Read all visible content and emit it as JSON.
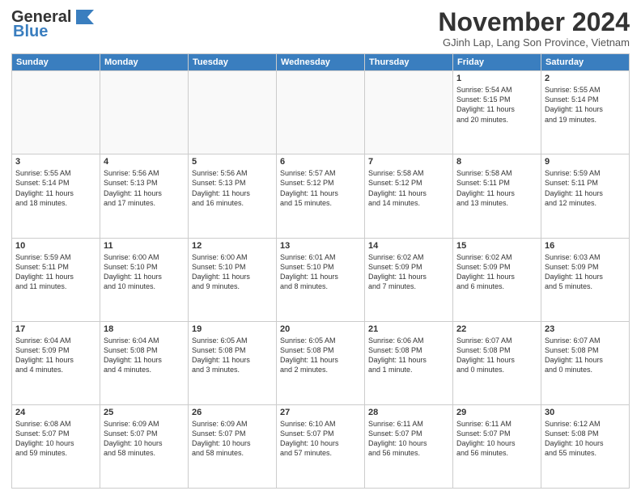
{
  "header": {
    "logo_line1": "General",
    "logo_line2": "Blue",
    "month": "November 2024",
    "location": "GJinh Lap, Lang Son Province, Vietnam"
  },
  "weekdays": [
    "Sunday",
    "Monday",
    "Tuesday",
    "Wednesday",
    "Thursday",
    "Friday",
    "Saturday"
  ],
  "weeks": [
    [
      {
        "day": "",
        "info": ""
      },
      {
        "day": "",
        "info": ""
      },
      {
        "day": "",
        "info": ""
      },
      {
        "day": "",
        "info": ""
      },
      {
        "day": "",
        "info": ""
      },
      {
        "day": "1",
        "info": "Sunrise: 5:54 AM\nSunset: 5:15 PM\nDaylight: 11 hours\nand 20 minutes."
      },
      {
        "day": "2",
        "info": "Sunrise: 5:55 AM\nSunset: 5:14 PM\nDaylight: 11 hours\nand 19 minutes."
      }
    ],
    [
      {
        "day": "3",
        "info": "Sunrise: 5:55 AM\nSunset: 5:14 PM\nDaylight: 11 hours\nand 18 minutes."
      },
      {
        "day": "4",
        "info": "Sunrise: 5:56 AM\nSunset: 5:13 PM\nDaylight: 11 hours\nand 17 minutes."
      },
      {
        "day": "5",
        "info": "Sunrise: 5:56 AM\nSunset: 5:13 PM\nDaylight: 11 hours\nand 16 minutes."
      },
      {
        "day": "6",
        "info": "Sunrise: 5:57 AM\nSunset: 5:12 PM\nDaylight: 11 hours\nand 15 minutes."
      },
      {
        "day": "7",
        "info": "Sunrise: 5:58 AM\nSunset: 5:12 PM\nDaylight: 11 hours\nand 14 minutes."
      },
      {
        "day": "8",
        "info": "Sunrise: 5:58 AM\nSunset: 5:11 PM\nDaylight: 11 hours\nand 13 minutes."
      },
      {
        "day": "9",
        "info": "Sunrise: 5:59 AM\nSunset: 5:11 PM\nDaylight: 11 hours\nand 12 minutes."
      }
    ],
    [
      {
        "day": "10",
        "info": "Sunrise: 5:59 AM\nSunset: 5:11 PM\nDaylight: 11 hours\nand 11 minutes."
      },
      {
        "day": "11",
        "info": "Sunrise: 6:00 AM\nSunset: 5:10 PM\nDaylight: 11 hours\nand 10 minutes."
      },
      {
        "day": "12",
        "info": "Sunrise: 6:00 AM\nSunset: 5:10 PM\nDaylight: 11 hours\nand 9 minutes."
      },
      {
        "day": "13",
        "info": "Sunrise: 6:01 AM\nSunset: 5:10 PM\nDaylight: 11 hours\nand 8 minutes."
      },
      {
        "day": "14",
        "info": "Sunrise: 6:02 AM\nSunset: 5:09 PM\nDaylight: 11 hours\nand 7 minutes."
      },
      {
        "day": "15",
        "info": "Sunrise: 6:02 AM\nSunset: 5:09 PM\nDaylight: 11 hours\nand 6 minutes."
      },
      {
        "day": "16",
        "info": "Sunrise: 6:03 AM\nSunset: 5:09 PM\nDaylight: 11 hours\nand 5 minutes."
      }
    ],
    [
      {
        "day": "17",
        "info": "Sunrise: 6:04 AM\nSunset: 5:09 PM\nDaylight: 11 hours\nand 4 minutes."
      },
      {
        "day": "18",
        "info": "Sunrise: 6:04 AM\nSunset: 5:08 PM\nDaylight: 11 hours\nand 4 minutes."
      },
      {
        "day": "19",
        "info": "Sunrise: 6:05 AM\nSunset: 5:08 PM\nDaylight: 11 hours\nand 3 minutes."
      },
      {
        "day": "20",
        "info": "Sunrise: 6:05 AM\nSunset: 5:08 PM\nDaylight: 11 hours\nand 2 minutes."
      },
      {
        "day": "21",
        "info": "Sunrise: 6:06 AM\nSunset: 5:08 PM\nDaylight: 11 hours\nand 1 minute."
      },
      {
        "day": "22",
        "info": "Sunrise: 6:07 AM\nSunset: 5:08 PM\nDaylight: 11 hours\nand 0 minutes."
      },
      {
        "day": "23",
        "info": "Sunrise: 6:07 AM\nSunset: 5:08 PM\nDaylight: 11 hours\nand 0 minutes."
      }
    ],
    [
      {
        "day": "24",
        "info": "Sunrise: 6:08 AM\nSunset: 5:07 PM\nDaylight: 10 hours\nand 59 minutes."
      },
      {
        "day": "25",
        "info": "Sunrise: 6:09 AM\nSunset: 5:07 PM\nDaylight: 10 hours\nand 58 minutes."
      },
      {
        "day": "26",
        "info": "Sunrise: 6:09 AM\nSunset: 5:07 PM\nDaylight: 10 hours\nand 58 minutes."
      },
      {
        "day": "27",
        "info": "Sunrise: 6:10 AM\nSunset: 5:07 PM\nDaylight: 10 hours\nand 57 minutes."
      },
      {
        "day": "28",
        "info": "Sunrise: 6:11 AM\nSunset: 5:07 PM\nDaylight: 10 hours\nand 56 minutes."
      },
      {
        "day": "29",
        "info": "Sunrise: 6:11 AM\nSunset: 5:07 PM\nDaylight: 10 hours\nand 56 minutes."
      },
      {
        "day": "30",
        "info": "Sunrise: 6:12 AM\nSunset: 5:08 PM\nDaylight: 10 hours\nand 55 minutes."
      }
    ]
  ]
}
